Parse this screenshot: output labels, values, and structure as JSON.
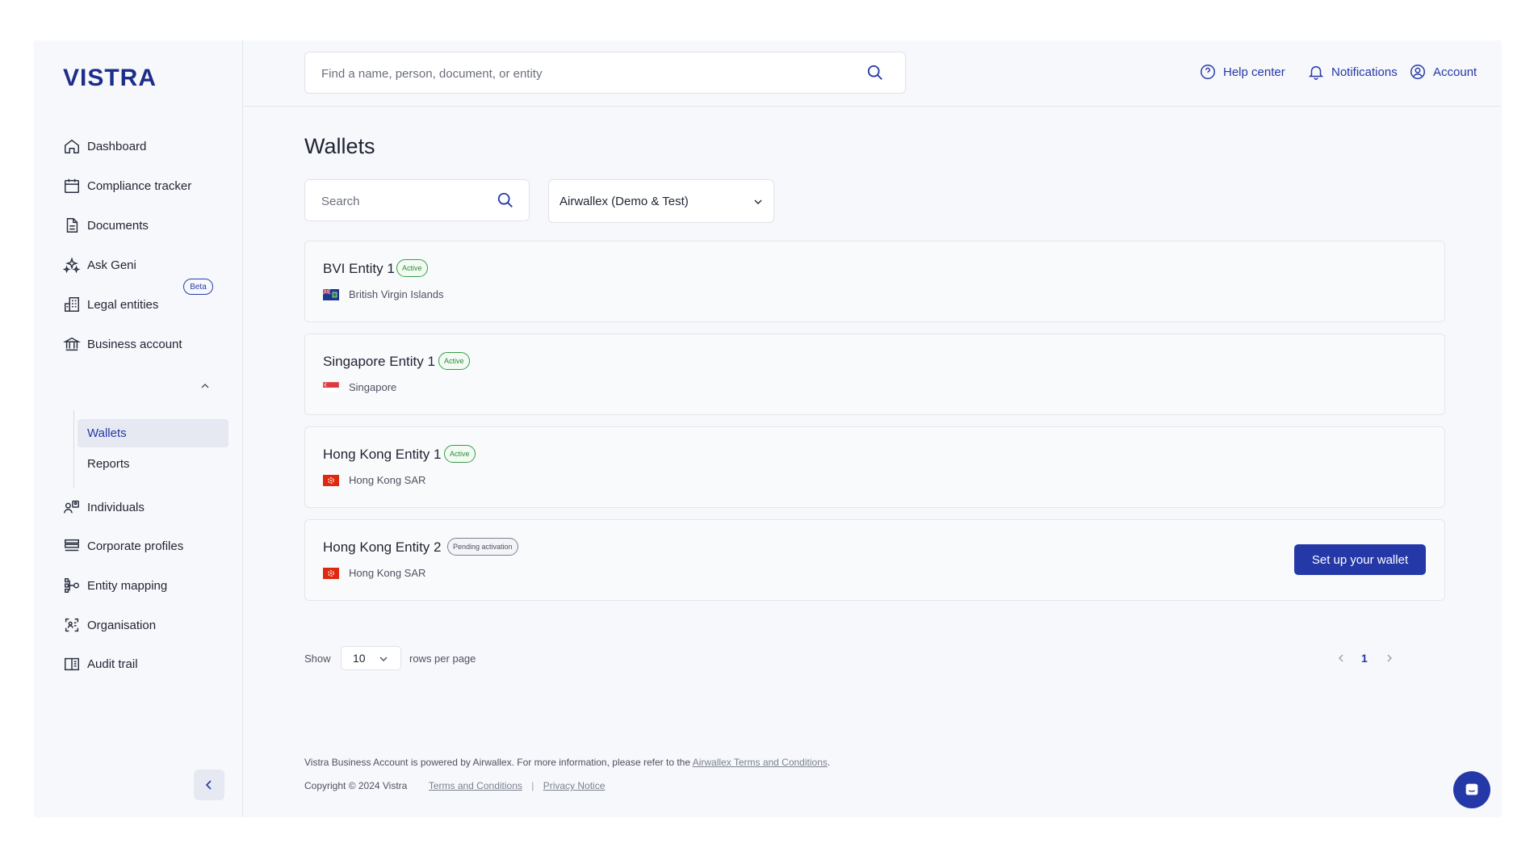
{
  "brand": {
    "logo": "VISTRA",
    "accent": "#2438a8"
  },
  "header": {
    "search_placeholder": "Find a name, person, document, or entity",
    "links": [
      {
        "label": "Help center",
        "icon": "help-circle-icon"
      },
      {
        "label": "Notifications",
        "icon": "bell-icon"
      },
      {
        "label": "Account",
        "icon": "user-circle-icon"
      }
    ]
  },
  "sidebar": {
    "items": [
      {
        "label": "Dashboard",
        "icon": "home-icon"
      },
      {
        "label": "Compliance tracker",
        "icon": "calendar-icon"
      },
      {
        "label": "Documents",
        "icon": "document-icon"
      },
      {
        "label": "Ask Geni",
        "icon": "sparkle-icon",
        "badge": "Beta"
      },
      {
        "label": "Legal entities",
        "icon": "building-icon"
      },
      {
        "label": "Business account",
        "icon": "bank-icon"
      },
      {
        "label": "Individuals",
        "icon": "individuals-icon"
      },
      {
        "label": "Corporate profiles",
        "icon": "stack-icon"
      },
      {
        "label": "Entity mapping",
        "icon": "hierarchy-icon"
      },
      {
        "label": "Organisation",
        "icon": "organisation-icon"
      },
      {
        "label": "Audit trail",
        "icon": "book-icon"
      }
    ],
    "business_sub": [
      {
        "label": "Wallets",
        "active": true
      },
      {
        "label": "Reports",
        "active": false
      }
    ]
  },
  "main": {
    "title": "Wallets",
    "search_placeholder": "Search",
    "account_select": "Airwallex (Demo & Test)",
    "entities": [
      {
        "name": "BVI Entity 1",
        "status": "Active",
        "country": "British Virgin Islands",
        "flag": "bvi"
      },
      {
        "name": "Singapore Entity 1",
        "status": "Active",
        "country": "Singapore",
        "flag": "sg"
      },
      {
        "name": "Hong Kong Entity 1",
        "status": "Active",
        "country": "Hong Kong SAR",
        "flag": "hk"
      },
      {
        "name": "Hong Kong Entity 2",
        "status": "Pending activation",
        "country": "Hong Kong SAR",
        "flag": "hk",
        "action": "Set up your wallet"
      }
    ],
    "pagination": {
      "show_label": "Show",
      "rows_value": "10",
      "rows_label": "rows per page",
      "current_page": "1"
    }
  },
  "footer": {
    "powered_text": "Vistra Business Account is powered by Airwallex. For more information, please refer to the",
    "powered_link": "Airwallex Terms and Conditions",
    "powered_end": ".",
    "copyright": "Copyright © 2024 Vistra",
    "terms": "Terms and Conditions",
    "separator": "|",
    "privacy": "Privacy Notice"
  }
}
